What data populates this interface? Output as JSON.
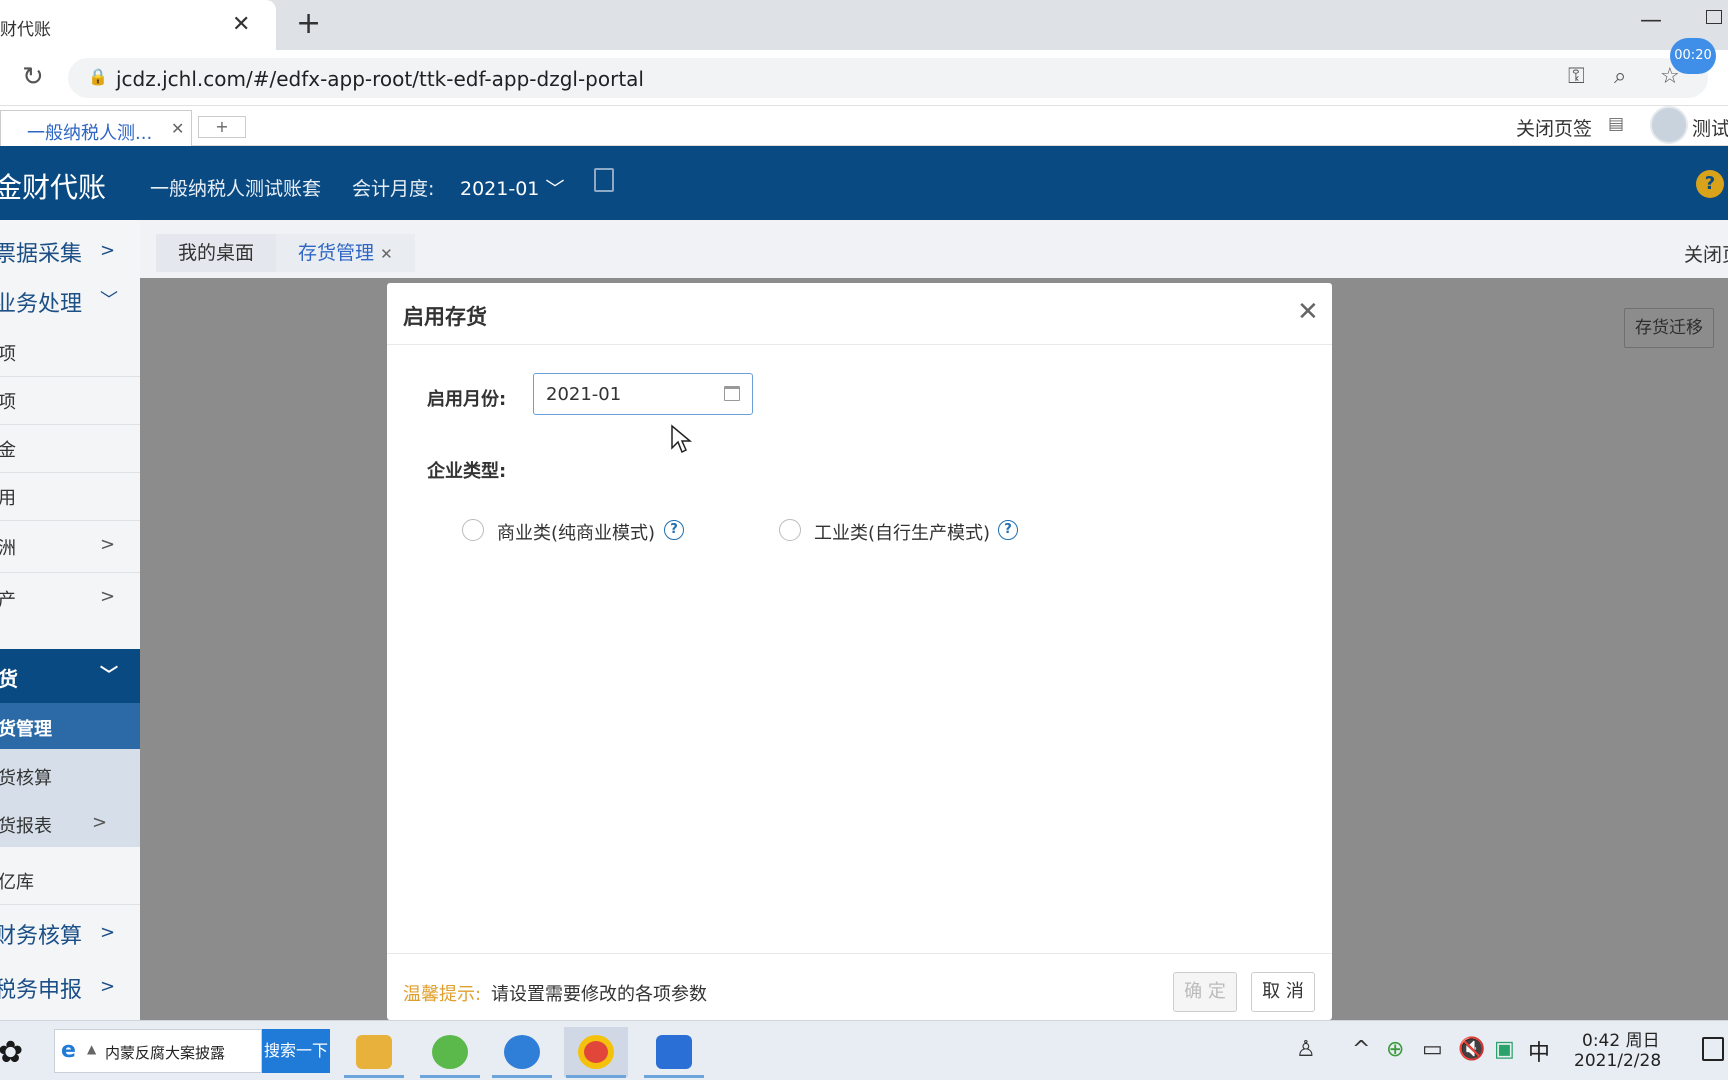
{
  "browser": {
    "tab_title": "财代账",
    "url": "jcdz.jchl.com/#/edfx-app-root/ttk-edf-app-dzgl-portal",
    "record_timer": "00:20"
  },
  "portal_tabs": {
    "active_tab": "一般纳税人测...",
    "add_label": "+",
    "close_tabs_label": "关闭页签",
    "username": "测试"
  },
  "header": {
    "brand": "金财代账",
    "account": "一般纳税人测试账套",
    "period_label": "会计月度:",
    "period_value": "2021-01",
    "help": "?"
  },
  "sidebar": {
    "items": [
      {
        "label": "票据采集"
      },
      {
        "label": "业务处理"
      },
      {
        "label": "项"
      },
      {
        "label": "项"
      },
      {
        "label": "金"
      },
      {
        "label": "用"
      },
      {
        "label": "洲"
      },
      {
        "label": "产"
      },
      {
        "label": "货"
      },
      {
        "label": "货管理"
      },
      {
        "label": "货核算"
      },
      {
        "label": "货报表"
      },
      {
        "label": "亿库"
      },
      {
        "label": "财务核算"
      },
      {
        "label": "税务申报"
      }
    ]
  },
  "content": {
    "tabs": [
      {
        "label": "我的桌面"
      },
      {
        "label": "存货管理"
      }
    ],
    "close_page": "关闭页",
    "migrate_button": "存货迁移"
  },
  "modal": {
    "title": "启用存货",
    "start_month_label": "启用月份:",
    "start_month_value": "2021-01",
    "enterprise_type_label": "企业类型:",
    "options": [
      {
        "label": "商业类(纯商业模式)"
      },
      {
        "label": "工业类(自行生产模式)"
      }
    ],
    "tip_label": "温馨提示:",
    "tip_text": "请设置需要修改的各项参数",
    "ok_label": "确 定",
    "cancel_label": "取 消"
  },
  "taskbar": {
    "search_text": "内蒙反腐大案披露",
    "search_button": "搜索一下",
    "ime": "中",
    "time": "0:42 周日",
    "date": "2021/2/28"
  },
  "colors": {
    "header_bg": "#0a4a82",
    "sidebar_active": "#0a4a82",
    "sidebar_selected": "#2b6aa6",
    "tip": "#e0a030",
    "link": "#2e66c5"
  }
}
